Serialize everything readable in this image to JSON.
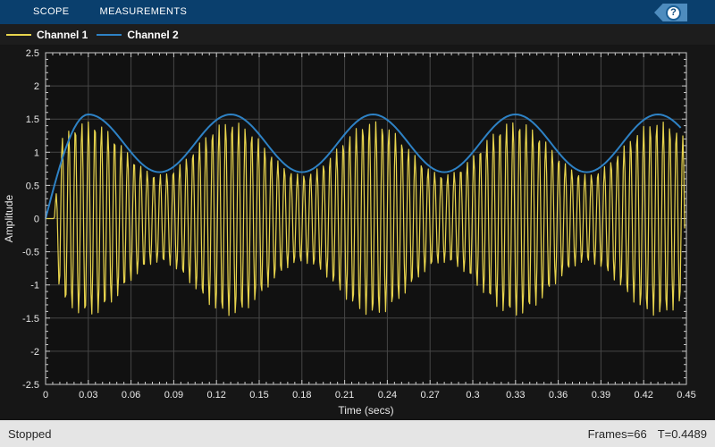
{
  "toolstrip": {
    "tabs": [
      {
        "label": "SCOPE"
      },
      {
        "label": "MEASUREMENTS"
      }
    ],
    "help_glyph": "?"
  },
  "status": {
    "left": "Stopped",
    "frames": "Frames=66",
    "time": "T=0.4489"
  },
  "colors": {
    "toolbar_bg": "#0a3f6d",
    "help_tag_bg": "#4e8cbe",
    "legend_bg": "#1d1d1d",
    "canvas_bg": "#161616",
    "plot_bg": "#111111",
    "grid": "#464646",
    "axis": "#c9c9c9",
    "tick_text": "#e8e8e8",
    "status_bg": "#e5e5e5",
    "status_text": "#262626",
    "channel1": "#e8d44d",
    "channel2": "#2e82c5"
  },
  "chart_data": {
    "type": "line",
    "title": "",
    "xlabel": "Time (secs)",
    "ylabel": "Amplitude",
    "xlim": [
      0,
      0.45
    ],
    "ylim": [
      -2.5,
      2.5
    ],
    "grid": true,
    "x_tick_values": [
      0,
      0.03,
      0.06,
      0.09,
      0.12,
      0.15,
      0.18,
      0.21,
      0.24,
      0.27,
      0.3,
      0.33,
      0.36,
      0.39,
      0.42,
      0.45
    ],
    "x_tick_labels": [
      "0",
      "0.03",
      "0.06",
      "0.09",
      "0.12",
      "0.15",
      "0.18",
      "0.21",
      "0.24",
      "0.27",
      "0.3",
      "0.33",
      "0.36",
      "0.39",
      "0.42",
      "0.45"
    ],
    "y_tick_values": [
      2.5,
      2,
      1.5,
      1,
      0.5,
      0,
      -0.5,
      -1,
      -1.5,
      -2,
      -2.5
    ],
    "y_tick_labels": [
      "2.5",
      "2",
      "1.5",
      "1",
      "0.5",
      "0",
      "-0.5",
      "-1",
      "-1.5",
      "-2",
      "-2.5"
    ],
    "x_minor_step": 0.005,
    "y_minor_step": 0.1,
    "legend_position": "top-left-strip",
    "series": [
      {
        "name": "Channel 1",
        "color": "#e8d44d",
        "kind": "am_carrier",
        "description": "amplitude-modulated sine, amplitude oscillates ~0.66 to ~1.46, peaks at t=0.03+k*0.1",
        "carrier_hz": 218,
        "mod_hz": 10,
        "amp_mean": 1.065,
        "amp_depth": 0.4,
        "envelope_peak_t": 0.03,
        "signal_start_t": 0.006,
        "ramp_duration": 0.004,
        "end_t": 0.4489,
        "sample_rate_hz": 1600,
        "line_width": 1.2
      },
      {
        "name": "Channel 2",
        "color": "#2e82c5",
        "kind": "envelope",
        "description": "smooth envelope, rises from 0 at t=0 to 1.57 at t=0.03, then oscillates 0.70 to 1.57 at 10 Hz",
        "mod_hz": 10,
        "mean": 1.135,
        "depth": 0.435,
        "peak_t": 0.03,
        "peak_value": 1.57,
        "end_t": 0.4469,
        "sample_rate_hz": 500,
        "line_width": 2
      }
    ]
  }
}
